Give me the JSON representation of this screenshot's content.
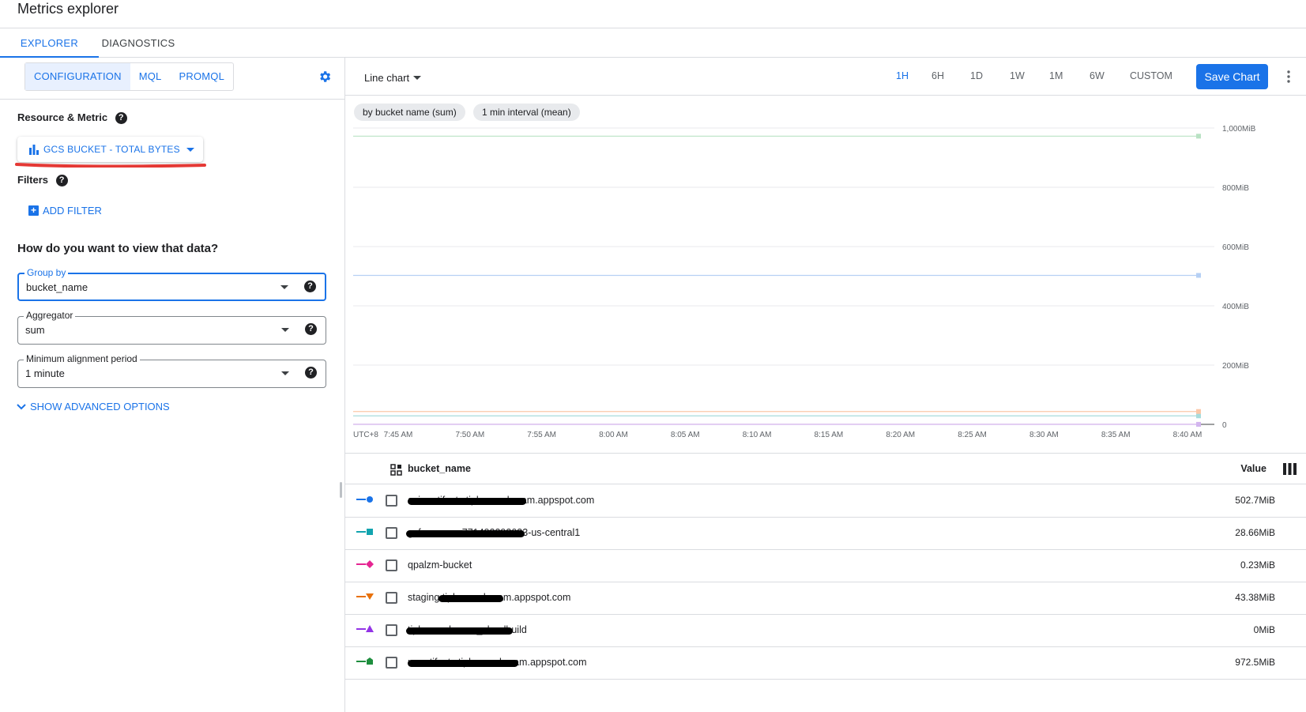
{
  "header": {
    "title": "Metrics explorer"
  },
  "tabs": [
    {
      "label": "EXPLORER",
      "active": true
    },
    {
      "label": "DIAGNOSTICS",
      "active": false
    }
  ],
  "left": {
    "modes": [
      {
        "label": "CONFIGURATION",
        "active": true
      },
      {
        "label": "MQL"
      },
      {
        "label": "PROMQL"
      }
    ],
    "resource_metric_label": "Resource & Metric",
    "metric_button": "GCS BUCKET - TOTAL BYTES",
    "filters_label": "Filters",
    "add_filter": "ADD FILTER",
    "view_heading": "How do you want to view that data?",
    "group_by": {
      "label": "Group by",
      "value": "bucket_name"
    },
    "aggregator": {
      "label": "Aggregator",
      "value": "sum"
    },
    "alignment": {
      "label": "Minimum alignment period",
      "value": "1 minute"
    },
    "advanced": "SHOW ADVANCED OPTIONS",
    "help_glyph": "?"
  },
  "toolbar": {
    "chart_type": "Line chart",
    "ranges": [
      {
        "label": "1H",
        "active": true
      },
      {
        "label": "6H"
      },
      {
        "label": "1D"
      },
      {
        "label": "1W"
      },
      {
        "label": "1M"
      },
      {
        "label": "6W"
      },
      {
        "label": "CUSTOM"
      }
    ],
    "save": "Save Chart"
  },
  "chips": [
    "by bucket name (sum)",
    "1 min interval (mean)"
  ],
  "chart_data": {
    "type": "line",
    "timezone_label": "UTC+8",
    "x": [
      "7:45 AM",
      "7:50 AM",
      "7:55 AM",
      "8:00 AM",
      "8:05 AM",
      "8:10 AM",
      "8:15 AM",
      "8:20 AM",
      "8:25 AM",
      "8:30 AM",
      "8:35 AM",
      "8:40 AM"
    ],
    "yticks": [
      "0",
      "200MiB",
      "400MiB",
      "600MiB",
      "800MiB",
      "1,000MiB"
    ],
    "ylim": [
      0,
      1000
    ],
    "yunit": "MiB",
    "series": [
      {
        "name": "asia.artifacts…appspot.com",
        "value": 502.7,
        "color": "#b6d0f4",
        "marker_color": "#1a73e8"
      },
      {
        "name": "gcf-sources-…-us-central1",
        "value": 28.66,
        "color": "#a8dcdc",
        "marker_color": "#12a4af"
      },
      {
        "name": "qpalzm-bucket",
        "value": 0.23,
        "color": "#f2a6cd",
        "marker_color": "#e52592"
      },
      {
        "name": "staging.…appspot.com",
        "value": 43.38,
        "color": "#fbc8a8",
        "marker_color": "#e8710a"
      },
      {
        "name": "…_cloudbuild",
        "value": 0,
        "color": "#d3b6ef",
        "marker_color": "#9334e6"
      },
      {
        "name": "us.artifacts…appspot.com",
        "value": 972.5,
        "color": "#b9e2c4",
        "marker_color": "#1e8e3e"
      }
    ]
  },
  "table": {
    "col_name": "bucket_name",
    "col_value": "Value",
    "rows": [
      {
        "name": "asia.artifacts.tiph-ooooharam.appspot.com",
        "value": "502.7MiB",
        "marker": "circle",
        "color": "#1a73e8"
      },
      {
        "name": "gcf-sources-771492292033-us-central1",
        "value": "28.66MiB",
        "marker": "square",
        "color": "#12a4af"
      },
      {
        "name": "qpalzm-bucket",
        "value": "0.23MiB",
        "marker": "diamond",
        "color": "#e52592"
      },
      {
        "name": "staging.tiph-ooooharam.appspot.com",
        "value": "43.38MiB",
        "marker": "tri-down",
        "color": "#e8710a"
      },
      {
        "name": "tiph-ooooharam_cloudbuild",
        "value": "0MiB",
        "marker": "tri-up",
        "color": "#9334e6"
      },
      {
        "name": "us.artifacts.tiph-ooooharam.appspot.com",
        "value": "972.5MiB",
        "marker": "home",
        "color": "#1e8e3e"
      }
    ]
  }
}
